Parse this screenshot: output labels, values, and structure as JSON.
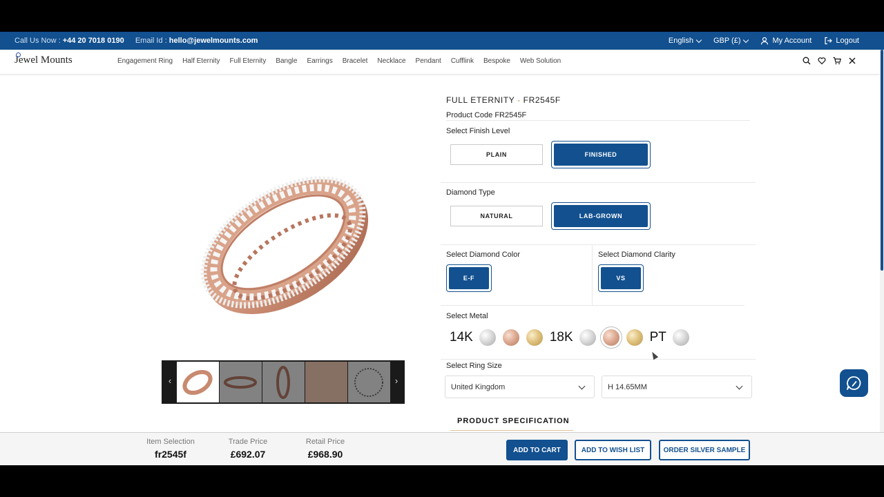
{
  "topbar": {
    "call_label": "Call Us Now :",
    "phone": "+44 20 7018 0190",
    "email_label": "Email Id :",
    "email": "hello@jewelmounts.com",
    "language": "English",
    "currency": "GBP (£)",
    "account": "My Account",
    "logout": "Logout"
  },
  "logo": {
    "text": "Jewel Mounts"
  },
  "menu": [
    "Engagement Ring",
    "Half Eternity",
    "Full Eternity",
    "Bangle",
    "Earrings",
    "Bracelet",
    "Necklace",
    "Pendant",
    "Cufflink",
    "Bespoke",
    "Web Solution"
  ],
  "product": {
    "category": "FULL ETERNITY",
    "separator": "-",
    "sku": "FR2545F",
    "code_label": "Product Code FR2545F",
    "finish_label": "Select Finish Level",
    "finish_options": [
      "PLAIN",
      "FINISHED"
    ],
    "diamond_type_label": "Diamond Type",
    "diamond_type_options": [
      "NATURAL",
      "LAB-GROWN"
    ],
    "color_label": "Select Diamond Color",
    "color_value": "E-F",
    "clarity_label": "Select Diamond Clarity",
    "clarity_value": "VS",
    "metal_label": "Select Metal",
    "metal_groups": [
      "14K",
      "18K",
      "PT"
    ],
    "ring_size_label": "Select Ring Size",
    "ring_size_country": "United Kingdom",
    "ring_size_value": "H 14.65MM",
    "spec_label": "PRODUCT SPECIFICATION"
  },
  "bottom": {
    "item_label": "Item Selection",
    "item_value": "fr2545f",
    "trade_label": "Trade Price",
    "trade_value": "£692.07",
    "retail_label": "Retail Price",
    "retail_value": "£968.90",
    "add_to_cart": "ADD TO CART",
    "add_to_wishlist": "ADD TO WISH LIST",
    "order_sample": "ORDER SILVER SAMPLE"
  },
  "colors": {
    "primary": "#12508f",
    "rose_gold": "#deab93",
    "yellow_gold": "#e0c27f",
    "white_gold": "#d9d9d9"
  }
}
